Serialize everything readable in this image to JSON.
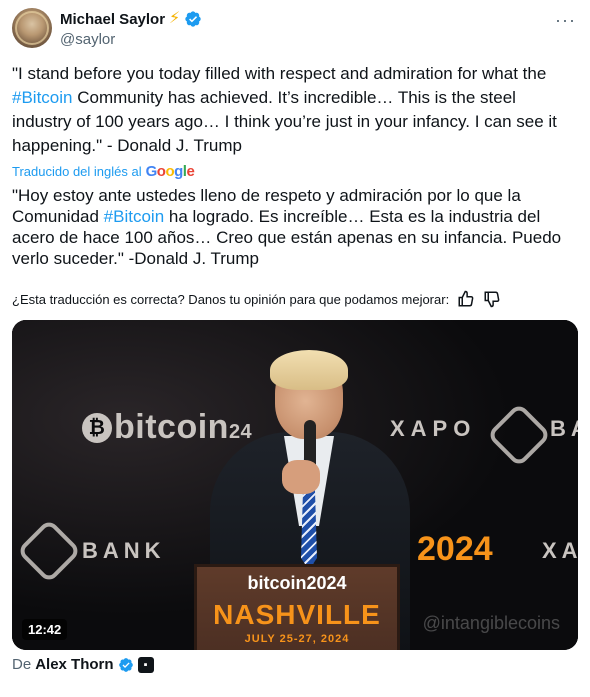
{
  "tweet": {
    "author_name": "Michael Saylor",
    "author_handle": "@saylor",
    "author_emoji": "⚡",
    "more_icon": "more-dots-icon",
    "original_text": {
      "part1": "\"I stand before you today filled with respect and admiration for what the ",
      "hashtag": "#Bitcoin",
      "part2": " Community has achieved. It’s incredible… This is the steel industry of 100 years ago… I think you’re just in your infancy. I can see it happening.\" - Donald J. Trump"
    },
    "translated_by": "Traducido del inglés al",
    "google_letters": [
      "G",
      "o",
      "o",
      "g",
      "l",
      "e"
    ],
    "translation_text": {
      "part1": "\"Hoy estoy ante ustedes lleno de respeto y admiración por lo que la Comunidad ",
      "hashtag": "#Bitcoin",
      "part2": " ha logrado. Es increíble… Esta es la industria del acero de hace 100 años… Creo que están apenas en su infancia. Puedo verlo suceder.\" -Donald J. Trump"
    },
    "feedback_prompt": "¿Esta traducción es correcta? Danos tu opinión para que podamos mejorar:",
    "video": {
      "duration": "12:42",
      "bitcoin_logo": "bitcoin",
      "bitcoin_logo_suffix": "24",
      "xapo_text": "XAPO",
      "bank_text": "BANK",
      "ba_text": "BA",
      "xa_text": "XA",
      "year_text": "2024",
      "podium_logo": "bitcoin2024",
      "podium_city": "NASHVILLE",
      "podium_dates": "JULY 25-27, 2024",
      "watermark": "@intangiblecoins"
    },
    "from_label": "De",
    "from_author": "Alex Thorn"
  },
  "colors": {
    "accent": "#1d9bf0",
    "text": "#0f1419",
    "muted": "#536471",
    "bitcoin_orange": "#f7931a"
  }
}
